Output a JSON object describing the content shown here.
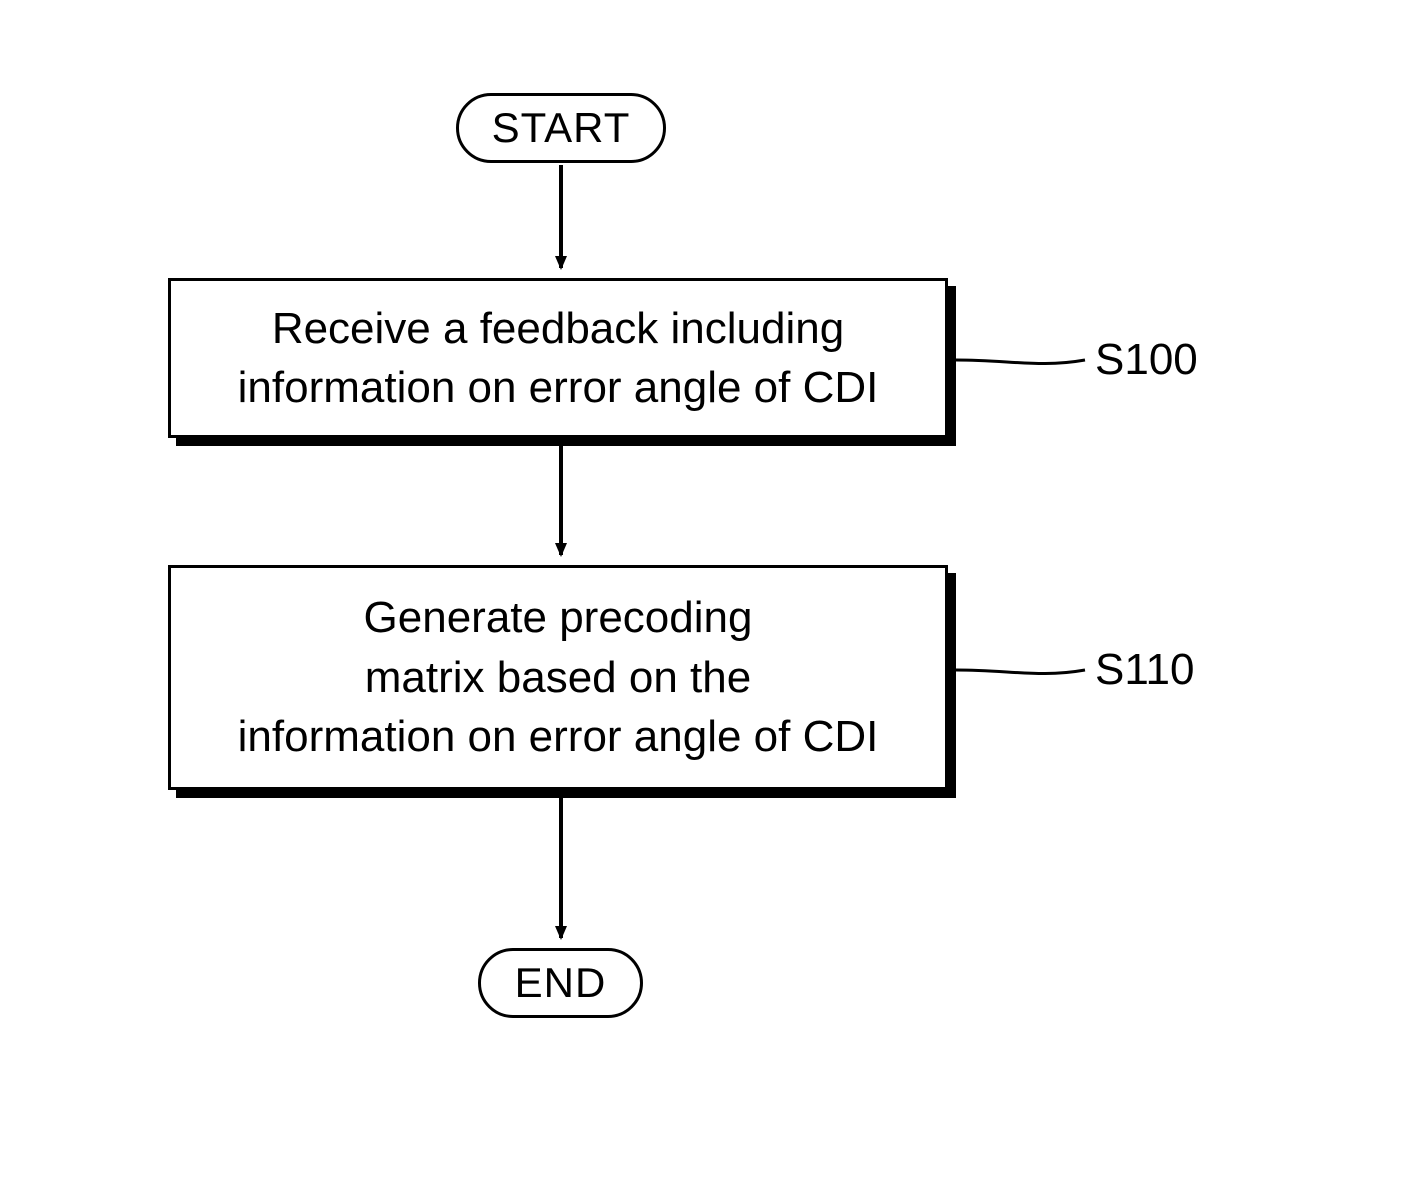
{
  "flow": {
    "start_label": "START",
    "end_label": "END",
    "steps": [
      {
        "id": "S100",
        "text": "Receive a feedback including\ninformation on error angle of CDI"
      },
      {
        "id": "S110",
        "text": "Generate precoding\nmatrix based on the\ninformation on error angle of CDI"
      }
    ]
  }
}
